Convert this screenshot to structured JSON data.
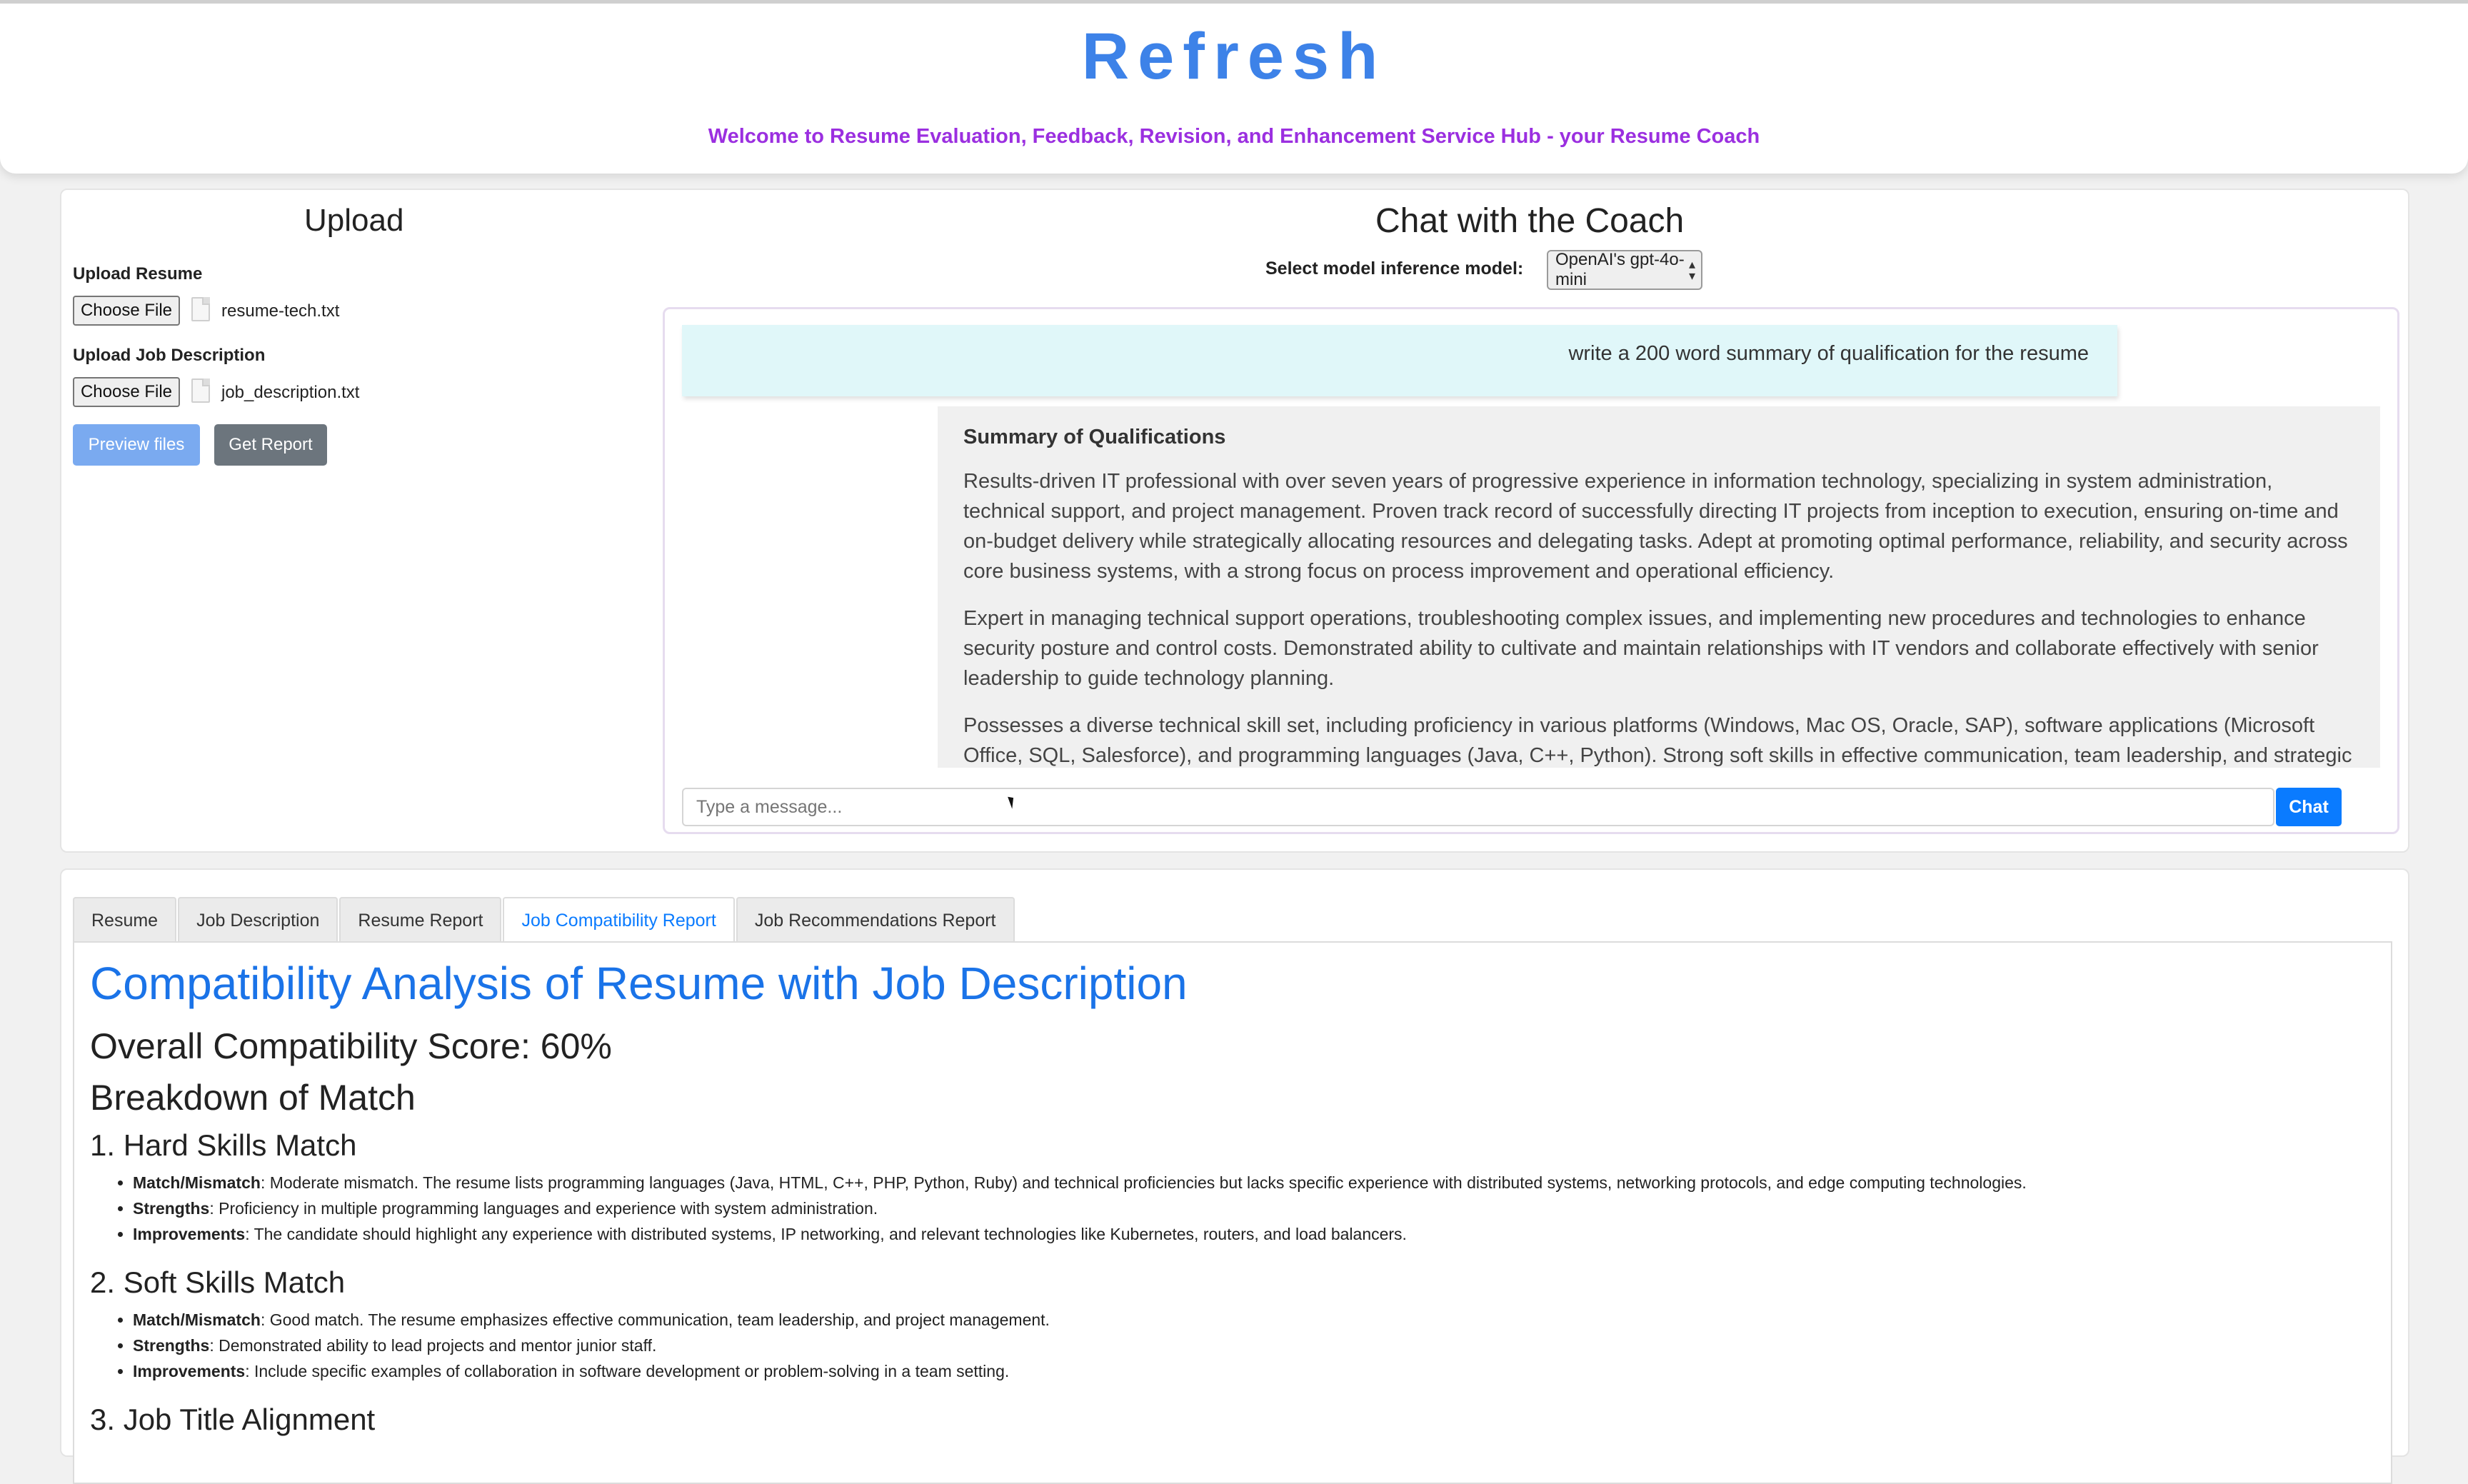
{
  "header": {
    "title": "Refresh",
    "subtitle": "Welcome to Resume Evaluation, Feedback, Revision, and Enhancement Service Hub - your Resume Coach"
  },
  "upload": {
    "title": "Upload",
    "resume_label": "Upload Resume",
    "resume_button": "Choose File",
    "resume_file": "resume-tech.txt",
    "job_label": "Upload Job Description",
    "job_button": "Choose File",
    "job_file": "job_description.txt",
    "preview_button": "Preview files",
    "report_button": "Get Report"
  },
  "chat": {
    "title": "Chat with the Coach",
    "model_label": "Select model inference model:",
    "model_selected": "OpenAI's gpt-4o-mini",
    "user_message": "write a 200 word summary of qualification for the resume",
    "bot_heading": "Summary of Qualifications",
    "bot_paragraphs": [
      "Results-driven IT professional with over seven years of progressive experience in information technology, specializing in system administration, technical support, and project management. Proven track record of successfully directing IT projects from inception to execution, ensuring on-time and on-budget delivery while strategically allocating resources and delegating tasks. Adept at promoting optimal performance, reliability, and security across core business systems, with a strong focus on process improvement and operational efficiency.",
      "Expert in managing technical support operations, troubleshooting complex issues, and implementing new procedures and technologies to enhance security posture and control costs. Demonstrated ability to cultivate and maintain relationships with IT vendors and collaborate effectively with senior leadership to guide technology planning.",
      "Possesses a diverse technical skill set, including proficiency in various platforms (Windows, Mac OS, Oracle, SAP), software applications (Microsoft Office, SQL, Salesforce), and programming languages (Java, C++, Python). Strong soft skills in effective communication, team leadership, and strategic"
    ],
    "input_placeholder": "Type a message...",
    "send_button": "Chat"
  },
  "tabs": [
    {
      "label": "Resume"
    },
    {
      "label": "Job Description"
    },
    {
      "label": "Resume Report"
    },
    {
      "label": "Job Compatibility Report",
      "active": true
    },
    {
      "label": "Job Recommendations Report"
    }
  ],
  "report": {
    "title": "Compatibility Analysis of Resume with Job Description",
    "overall": "Overall Compatibility Score: 60%",
    "breakdown": "Breakdown of Match",
    "sections": [
      {
        "heading": "1. Hard Skills Match",
        "items": [
          {
            "key": "Match/Mismatch",
            "text": ": Moderate mismatch. The resume lists programming languages (Java, HTML, C++, PHP, Python, Ruby) and technical proficiencies but lacks specific experience with distributed systems, networking protocols, and edge computing technologies."
          },
          {
            "key": "Strengths",
            "text": ": Proficiency in multiple programming languages and experience with system administration."
          },
          {
            "key": "Improvements",
            "text": ": The candidate should highlight any experience with distributed systems, IP networking, and relevant technologies like Kubernetes, routers, and load balancers."
          }
        ]
      },
      {
        "heading": "2. Soft Skills Match",
        "items": [
          {
            "key": "Match/Mismatch",
            "text": ": Good match. The resume emphasizes effective communication, team leadership, and project management."
          },
          {
            "key": "Strengths",
            "text": ": Demonstrated ability to lead projects and mentor junior staff."
          },
          {
            "key": "Improvements",
            "text": ": Include specific examples of collaboration in software development or problem-solving in a team setting."
          }
        ]
      },
      {
        "heading": "3. Job Title Alignment",
        "items": []
      }
    ]
  }
}
